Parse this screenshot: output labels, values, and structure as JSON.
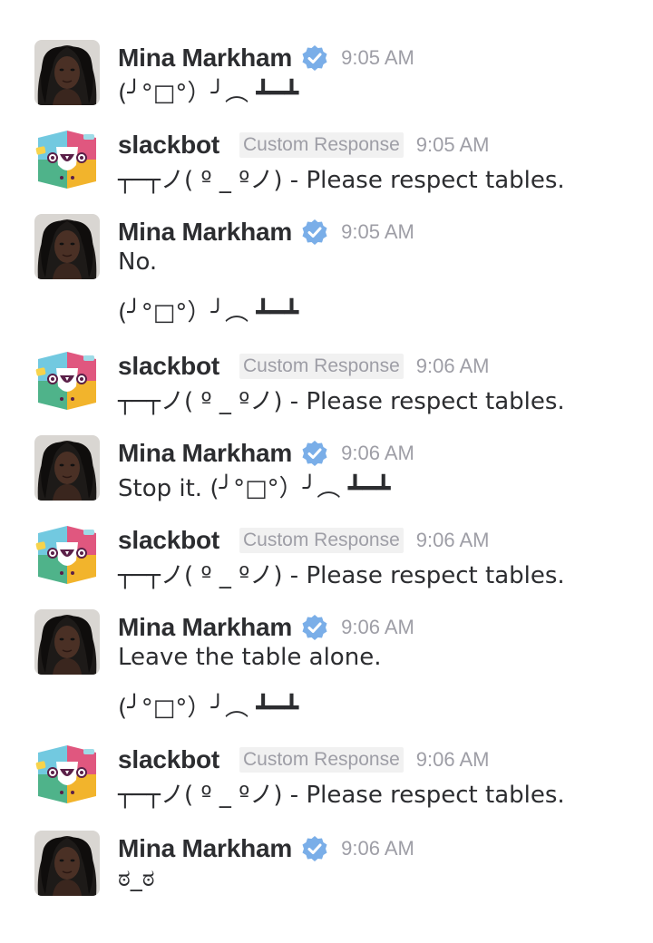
{
  "colors": {
    "name": "#2c2d30",
    "meta": "#9e9ea6",
    "verified": "#7aaee8",
    "tag_bg": "#f1f1f1"
  },
  "messages": [
    {
      "sender": "Mina Markham",
      "verified": true,
      "time": "9:05 AM",
      "lines": [
        "(╯°□°）╯︵ ┻━┻"
      ]
    },
    {
      "sender": "slackbot",
      "tag": "Custom Response",
      "time": "9:05 AM",
      "lines": [
        "┬─┬ノ( º _ ºノ) - Please respect tables."
      ]
    },
    {
      "sender": "Mina Markham",
      "verified": true,
      "time": "9:05 AM",
      "lines": [
        "No.",
        "(╯°□°）╯︵ ┻━┻"
      ]
    },
    {
      "sender": "slackbot",
      "tag": "Custom Response",
      "time": "9:06 AM",
      "lines": [
        "┬─┬ノ( º _ ºノ) - Please respect tables."
      ]
    },
    {
      "sender": "Mina Markham",
      "verified": true,
      "time": "9:06 AM",
      "lines": [
        "Stop it. (╯°□°）╯︵ ┻━┻"
      ]
    },
    {
      "sender": "slackbot",
      "tag": "Custom Response",
      "time": "9:06 AM",
      "lines": [
        "┬─┬ノ( º _ ºノ) - Please respect tables."
      ]
    },
    {
      "sender": "Mina Markham",
      "verified": true,
      "time": "9:06 AM",
      "lines": [
        "Leave the table alone.",
        "(╯°□°）╯︵ ┻━┻"
      ]
    },
    {
      "sender": "slackbot",
      "tag": "Custom Response",
      "time": "9:06 AM",
      "lines": [
        "┬─┬ノ( º _ ºノ) - Please respect tables."
      ]
    },
    {
      "sender": "Mina Markham",
      "verified": true,
      "time": "9:06 AM",
      "lines": [
        "ಠ_ಠ"
      ]
    }
  ]
}
